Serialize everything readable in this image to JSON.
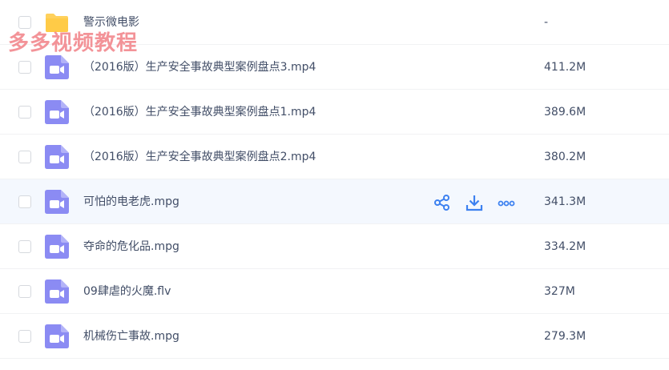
{
  "watermark": "多多视频教程",
  "colors": {
    "accent": "#3d81f0",
    "video_icon": "#8b8bf3",
    "folder_icon": "#ffd15c",
    "hover_row": "#f4f8fe"
  },
  "files": [
    {
      "name": "警示微电影",
      "size": "-",
      "type": "folder-icon"
    },
    {
      "name": "（2016版）生产安全事故典型案例盘点3.mp4",
      "size": "411.2M",
      "type": "video-icon"
    },
    {
      "name": "（2016版）生产安全事故典型案例盘点1.mp4",
      "size": "389.6M",
      "type": "video-icon"
    },
    {
      "name": "（2016版）生产安全事故典型案例盘点2.mp4",
      "size": "380.2M",
      "type": "video-icon"
    },
    {
      "name": "可怕的电老虎.mpg",
      "size": "341.3M",
      "type": "video-icon",
      "hovered": true
    },
    {
      "name": "夺命的危化品.mpg",
      "size": "334.2M",
      "type": "video-icon"
    },
    {
      "name": "09肆虐的火魔.flv",
      "size": "327M",
      "type": "video-icon"
    },
    {
      "name": "机械伤亡事故.mpg",
      "size": "279.3M",
      "type": "video-icon"
    }
  ],
  "row_actions": [
    "share-icon",
    "download-icon",
    "more-icon"
  ]
}
